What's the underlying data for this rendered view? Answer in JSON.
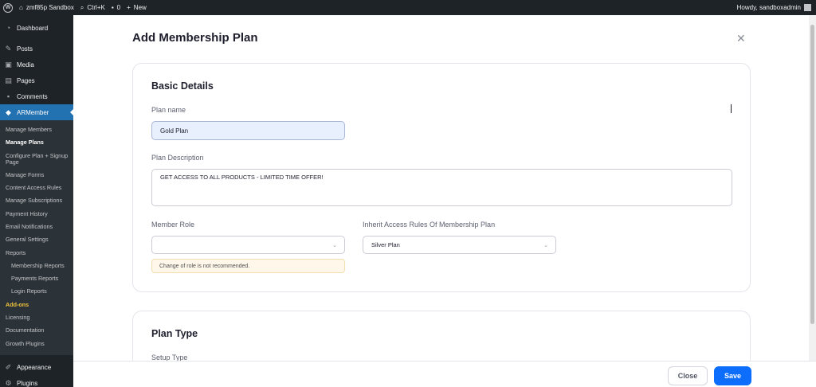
{
  "adminbar": {
    "site_name": "zmf85p Sandbox",
    "search_shortcut": "Ctrl+K",
    "comments_count": "0",
    "new_label": "New",
    "howdy": "Howdy, sandboxadmin"
  },
  "sidebar": {
    "dashboard": "Dashboard",
    "posts": "Posts",
    "media": "Media",
    "pages": "Pages",
    "comments": "Comments",
    "armember": "ARMember",
    "sub": {
      "manage_members": "Manage Members",
      "manage_plans": "Manage Plans",
      "configure_plan": "Configure Plan + Signup Page",
      "manage_forms": "Manage Forms",
      "content_access_rules": "Content Access Rules",
      "manage_subscriptions": "Manage Subscriptions",
      "payment_history": "Payment History",
      "email_notifications": "Email Notifications",
      "general_settings": "General Settings",
      "reports": "Reports",
      "membership_reports": "Membership Reports",
      "payments_reports": "Payments Reports",
      "login_reports": "Login Reports",
      "add_ons": "Add-ons",
      "licensing": "Licensing",
      "documentation": "Documentation",
      "growth_plugins": "Growth Plugins"
    },
    "appearance": "Appearance",
    "plugins": "Plugins"
  },
  "modal": {
    "title": "Add Membership Plan",
    "basic_details": {
      "heading": "Basic Details",
      "plan_name_label": "Plan name",
      "plan_name_value": "Gold Plan",
      "plan_description_label": "Plan Description",
      "plan_description_value": "GET ACCESS TO ALL PRODUCTS - LIMITED TIME OFFER!",
      "member_role_label": "Member Role",
      "member_role_value": "",
      "role_warning": "Change of role is not recommended.",
      "inherit_label": "Inherit Access Rules Of Membership Plan",
      "inherit_value": "Silver Plan"
    },
    "plan_type": {
      "heading": "Plan Type",
      "setup_type_label": "Setup Type"
    },
    "close_button": "Close",
    "save_button": "Save"
  },
  "colors": {
    "sidebar_bg": "#1d2327",
    "active_menu": "#2271b1",
    "primary_button": "#0d6efd",
    "warning_bg": "#fef7ea"
  }
}
